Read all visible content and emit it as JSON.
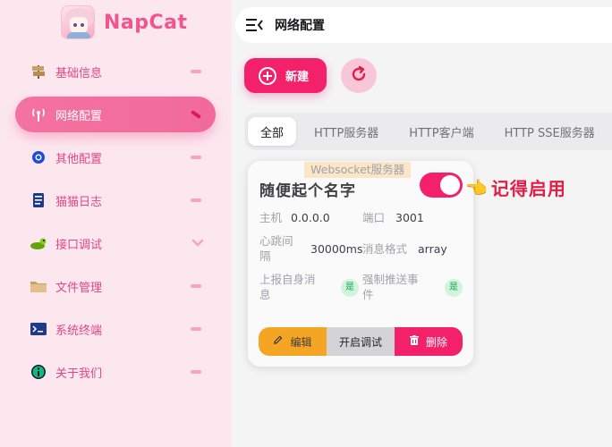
{
  "brand": {
    "name": "NapCat"
  },
  "sidebar": {
    "items": [
      {
        "label": "基础信息",
        "icon": "signpost-icon"
      },
      {
        "label": "网络配置",
        "icon": "antenna-icon",
        "active": true
      },
      {
        "label": "其他配置",
        "icon": "gear-icon"
      },
      {
        "label": "猫猫日志",
        "icon": "log-book-icon"
      },
      {
        "label": "接口调试",
        "icon": "bug-icon"
      },
      {
        "label": "文件管理",
        "icon": "folder-icon"
      },
      {
        "label": "系统终端",
        "icon": "terminal-icon"
      },
      {
        "label": "关于我们",
        "icon": "info-icon"
      }
    ]
  },
  "header": {
    "title": "网络配置"
  },
  "toolbar": {
    "new_label": "新建"
  },
  "tabs": [
    {
      "label": "全部",
      "active": true
    },
    {
      "label": "HTTP服务器"
    },
    {
      "label": "HTTP客户端"
    },
    {
      "label": "HTTP SSE服务器"
    }
  ],
  "card": {
    "name": "随便起个名字",
    "type": "Websocket服务器",
    "enabled": true,
    "host_label": "主机",
    "host_value": "0.0.0.0",
    "port_label": "端口",
    "port_value": "3001",
    "heartbeat_label_1": "心跳间",
    "heartbeat_label_2": "隔",
    "heartbeat_value": "30000ms",
    "format_label": "消息格式",
    "format_value": "array",
    "report_self_label_1": "上报自身消",
    "report_self_label_2": "息",
    "report_self_value": "是",
    "force_push_label_1": "强制推送事",
    "force_push_label_2": "件",
    "force_push_value": "是",
    "edit_label": "编辑",
    "debug_label": "开启调试",
    "delete_label": "删除"
  },
  "annotation": {
    "text": "记得启用"
  },
  "colors": {
    "accent": "#f3206a",
    "sidebar_bg": "#fce7ef",
    "edit": "#f5a524"
  }
}
